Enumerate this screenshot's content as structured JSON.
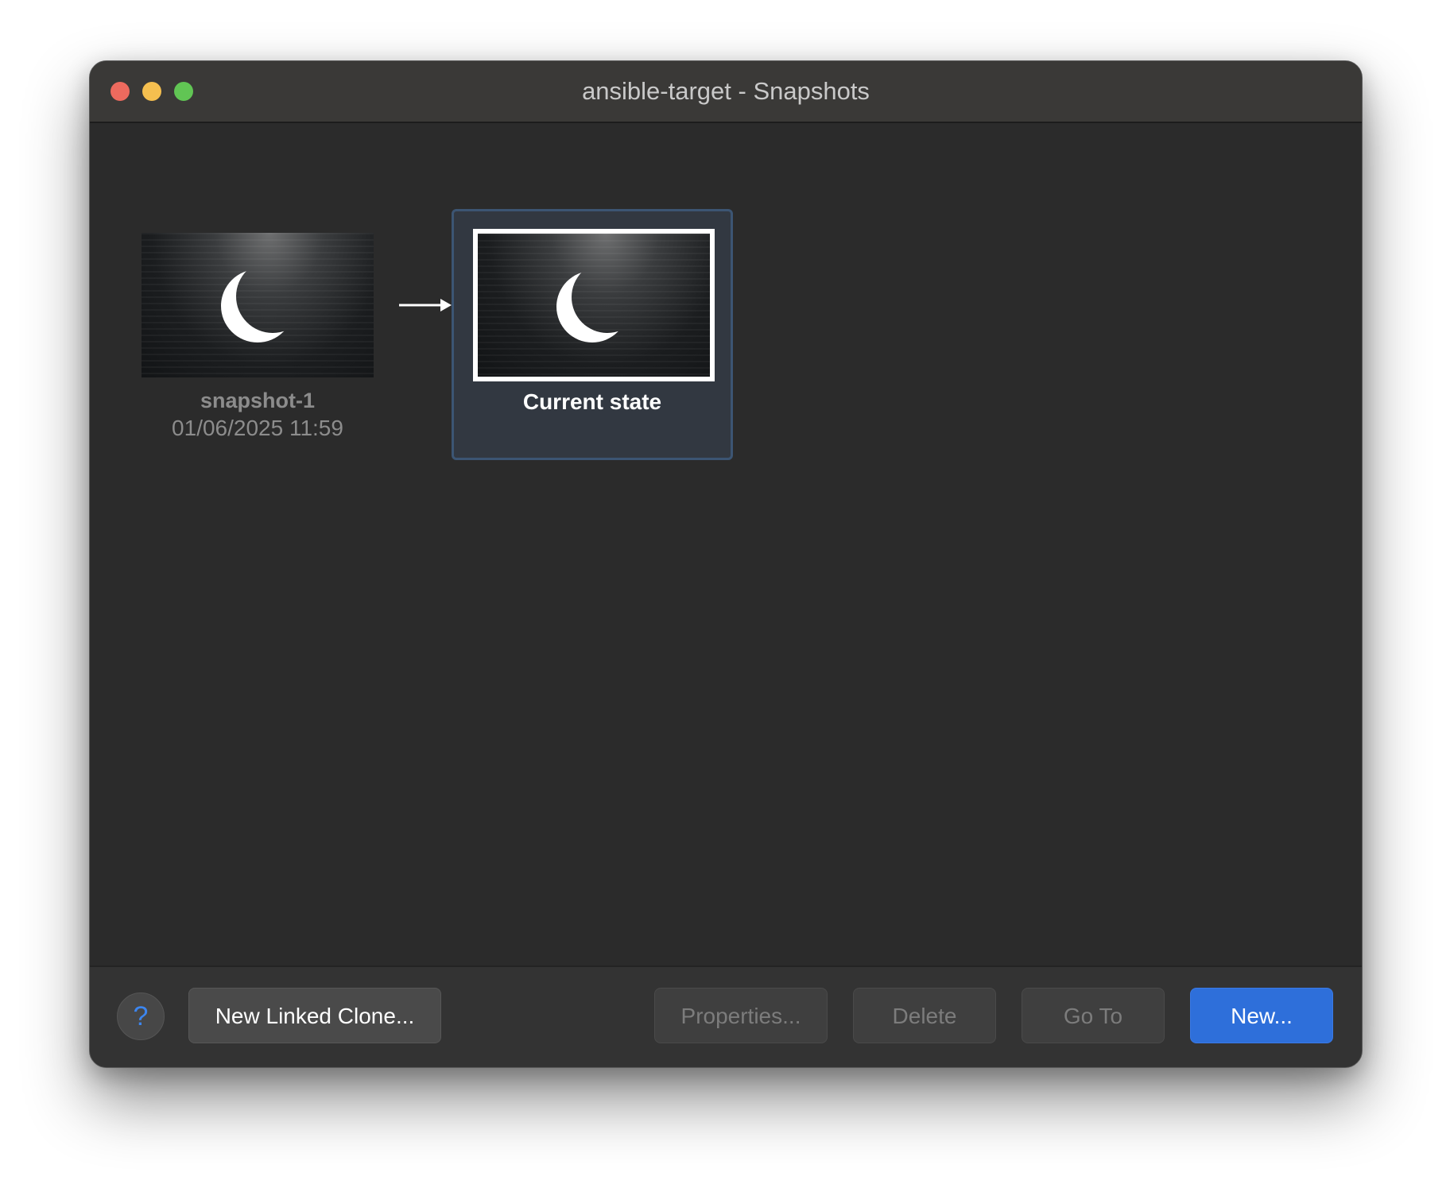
{
  "window": {
    "title": "ansible-target - Snapshots"
  },
  "snapshots": [
    {
      "name": "snapshot-1",
      "date": "01/06/2025 11:59"
    }
  ],
  "current": {
    "label": "Current state"
  },
  "footer": {
    "help_label": "?",
    "new_linked_clone_label": "New Linked Clone...",
    "properties_label": "Properties...",
    "delete_label": "Delete",
    "goto_label": "Go To",
    "new_label": "New..."
  },
  "colors": {
    "accent": "#2e6fda",
    "selection_border": "#3c5573",
    "selection_bg": "#323841"
  },
  "icons": {
    "thumbnail_logo": "crescent-moon-icon",
    "link_arrow": "right-arrow-icon",
    "help": "question-mark-icon"
  }
}
